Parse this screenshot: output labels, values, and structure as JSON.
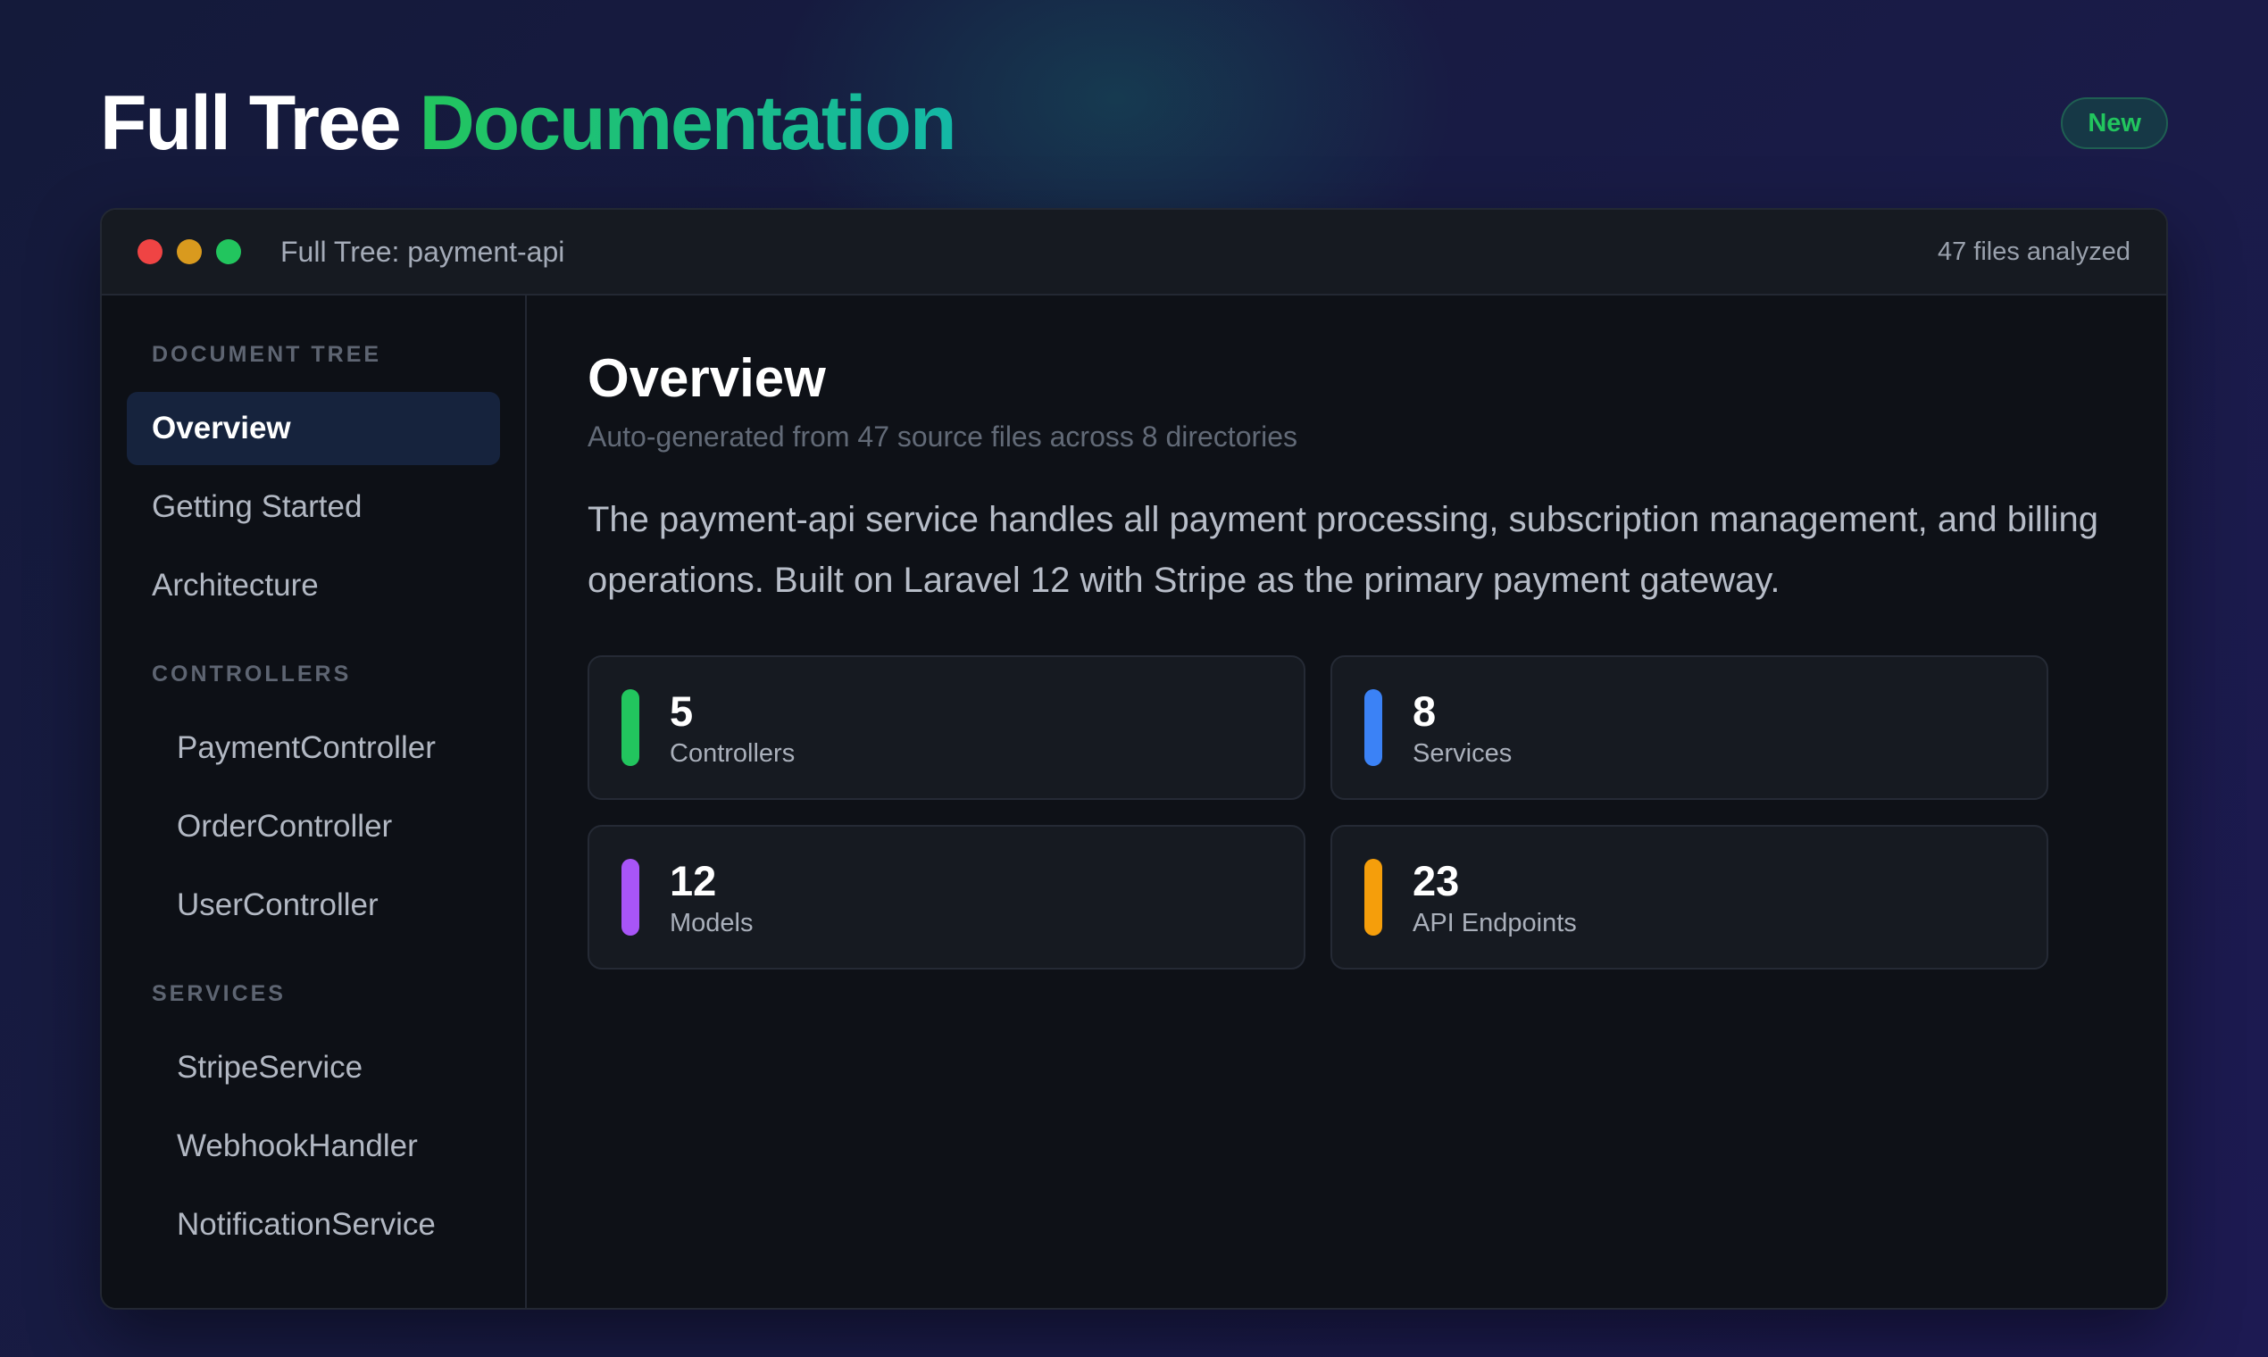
{
  "header": {
    "title_plain": "Full Tree",
    "title_accent": "Documentation",
    "badge": "New"
  },
  "window": {
    "title": "Full Tree: payment-api",
    "files_analyzed": "47 files analyzed"
  },
  "sidebar": {
    "sections": [
      {
        "label": "DOCUMENT TREE",
        "items": [
          "Overview",
          "Getting Started",
          "Architecture"
        ]
      },
      {
        "label": "CONTROLLERS",
        "items": [
          "PaymentController",
          "OrderController",
          "UserController"
        ]
      },
      {
        "label": "SERVICES",
        "items": [
          "StripeService",
          "WebhookHandler",
          "NotificationService"
        ]
      }
    ],
    "active_item": "Overview"
  },
  "main": {
    "title": "Overview",
    "subtitle": "Auto-generated from 47 source files across 8 directories",
    "description": "The payment-api service handles all payment processing, subscription management, and billing operations. Built on Laravel 12 with Stripe as the primary payment gateway.",
    "stats": [
      {
        "value": "5",
        "label": "Controllers",
        "color": "#22c55e"
      },
      {
        "value": "8",
        "label": "Services",
        "color": "#3b82f6"
      },
      {
        "value": "12",
        "label": "Models",
        "color": "#a855f7"
      },
      {
        "value": "23",
        "label": "API Endpoints",
        "color": "#f59e0b"
      }
    ]
  }
}
